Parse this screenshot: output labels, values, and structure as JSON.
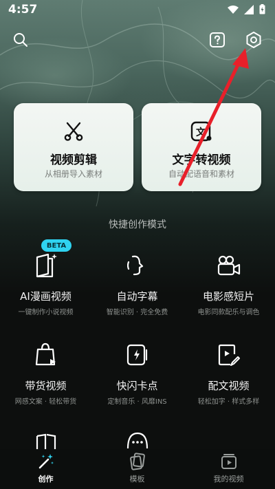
{
  "status_bar": {
    "time": "4:57"
  },
  "top_bar": {
    "search_icon": "search-icon",
    "help_icon": "help-icon",
    "settings_icon": "gear-icon"
  },
  "hero_cards": [
    {
      "title": "视频剪辑",
      "subtitle": "从相册导入素材",
      "icon": "scissors-icon"
    },
    {
      "title": "文字转视频",
      "subtitle": "自动配语音和素材",
      "icon": "text-video-icon"
    }
  ],
  "section": {
    "title": "快捷创作模式"
  },
  "modes": [
    {
      "title": "AI漫画视频",
      "subtitle": "一键制作小说视频",
      "badge": "BETA",
      "icon": "ai-comic-icon"
    },
    {
      "title": "自动字幕",
      "subtitle": "智能识别 · 完全免费",
      "icon": "caption-icon"
    },
    {
      "title": "电影感短片",
      "subtitle": "电影同款配乐与调色",
      "icon": "movie-camera-icon"
    },
    {
      "title": "带货视频",
      "subtitle": "网感文案 · 轻松带货",
      "icon": "shopping-bag-icon"
    },
    {
      "title": "快闪卡点",
      "subtitle": "定制音乐 · 风靡INS",
      "icon": "flash-icon"
    },
    {
      "title": "配文视频",
      "subtitle": "轻松加字 · 样式多样",
      "icon": "edit-video-icon"
    }
  ],
  "tabs": [
    {
      "label": "创作",
      "active": true,
      "icon": "magic-wand-icon"
    },
    {
      "label": "模板",
      "active": false,
      "icon": "template-icon"
    },
    {
      "label": "我的视频",
      "active": false,
      "icon": "my-video-icon"
    }
  ],
  "colors": {
    "accent_beta": "#2fd3f0",
    "arrow": "#e8202a",
    "card_bg": "#eef4f0"
  }
}
